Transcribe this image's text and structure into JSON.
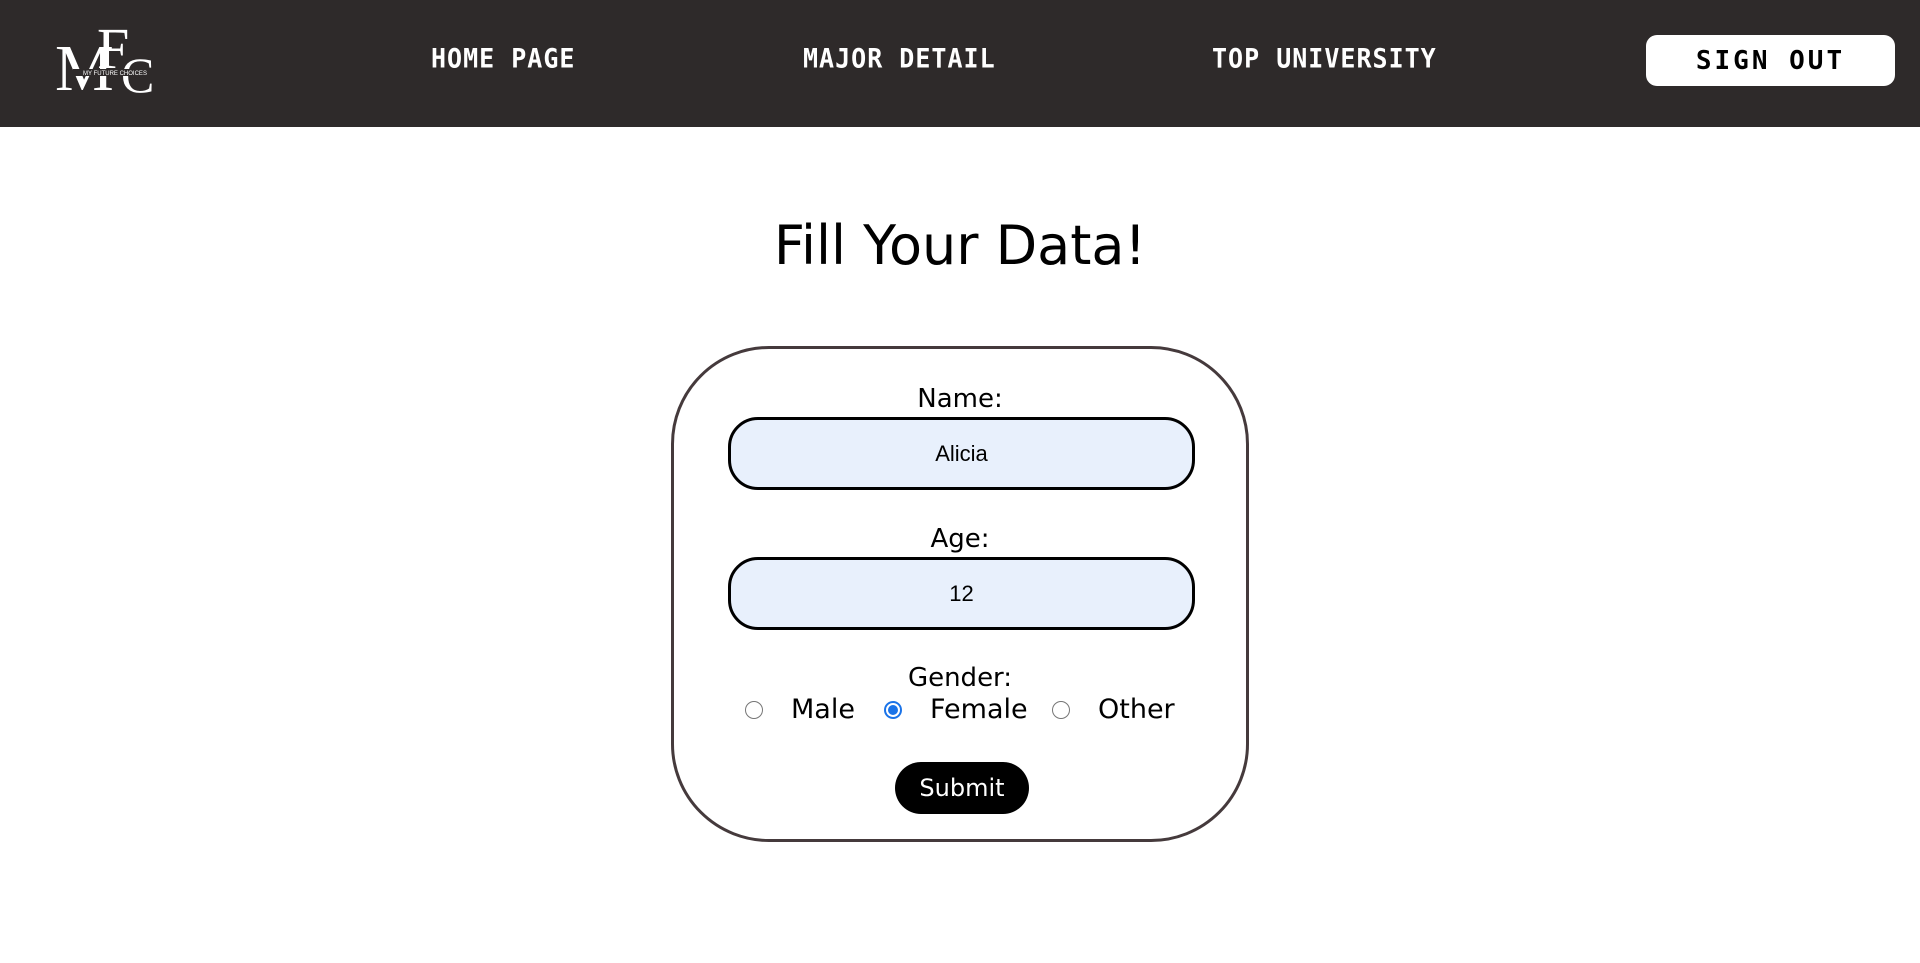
{
  "header": {
    "logo_text": "MFC",
    "logo_subtext": "MY FUTURE CHOICES",
    "nav": {
      "home": "HOME PAGE",
      "major": "MAJOR DETAIL",
      "top": "TOP UNIVERSITY"
    },
    "signout_label": "SIGN OUT"
  },
  "main": {
    "title": "Fill Your Data!"
  },
  "form": {
    "name_label": "Name:",
    "name_value": "Alicia",
    "age_label": "Age:",
    "age_value": "12",
    "gender_label": "Gender:",
    "gender_options": [
      "Male",
      "Female",
      "Other"
    ],
    "gender_selected": "Female",
    "submit_label": "Submit"
  },
  "colors": {
    "navbar_bg": "#2e2a2a",
    "input_bg": "#e8f0fc",
    "card_border": "#453a3c",
    "radio_accent": "#1a73e8"
  }
}
